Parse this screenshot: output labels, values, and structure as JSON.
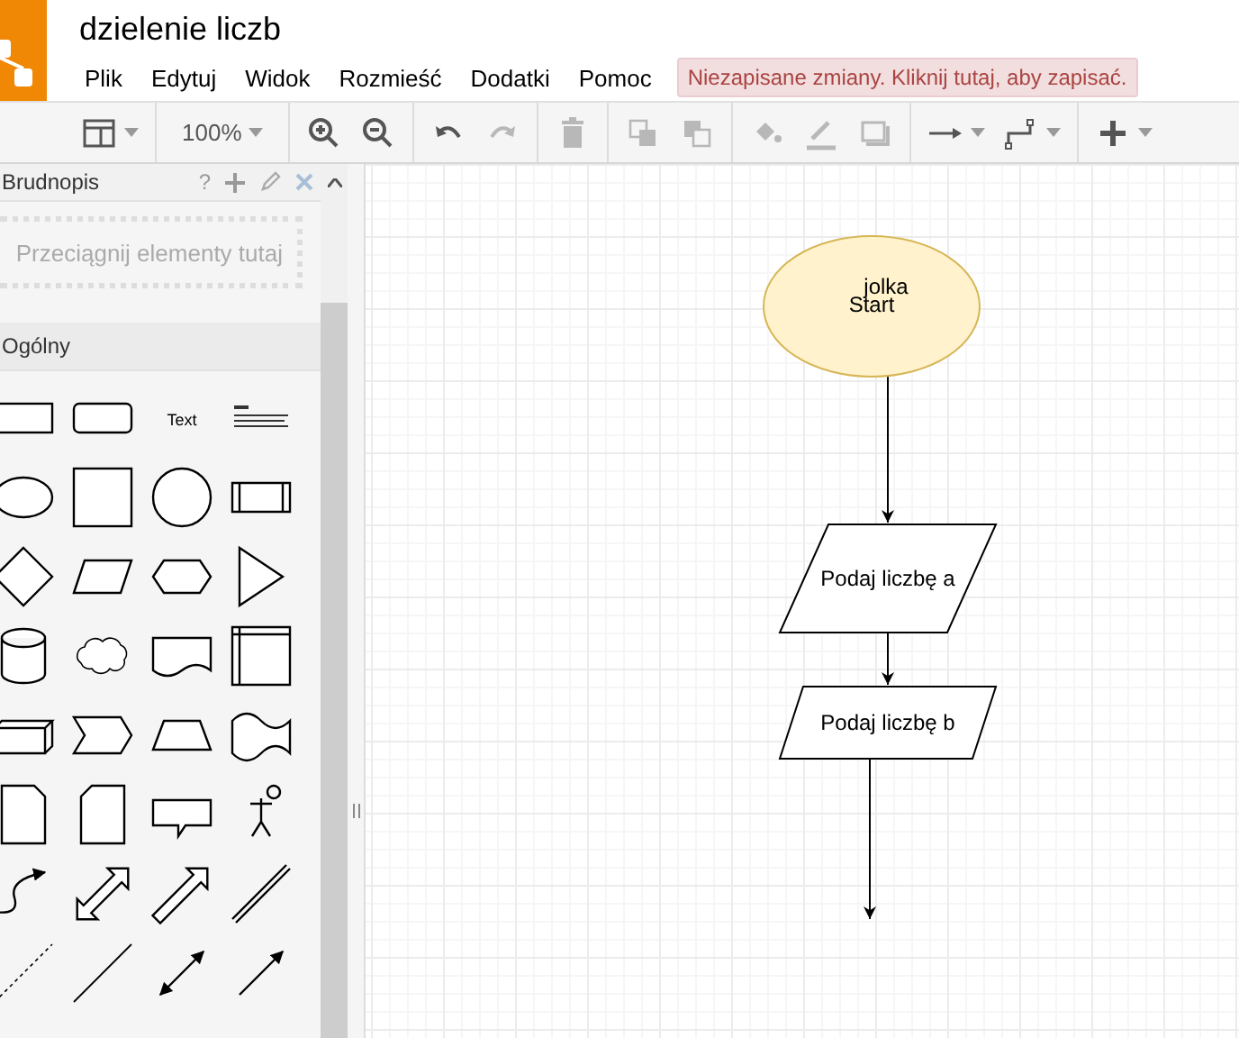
{
  "app": {
    "title": "dzielenie liczb"
  },
  "menu": [
    {
      "label": "Plik"
    },
    {
      "label": "Edytuj"
    },
    {
      "label": "Widok"
    },
    {
      "label": "Rozmieść"
    },
    {
      "label": "Dodatki"
    },
    {
      "label": "Pomoc"
    }
  ],
  "save_notice": "Niezapisane zmiany. Kliknij tutaj, aby zapisać.",
  "toolbar": {
    "tools": [
      {
        "kind": "format",
        "disabled": false
      },
      {
        "kind": "separator"
      },
      {
        "kind": "zoom",
        "label": "100%",
        "disabled": false
      },
      {
        "kind": "separator"
      },
      {
        "kind": "zoom-in",
        "disabled": false
      },
      {
        "kind": "zoom-out",
        "disabled": false
      },
      {
        "kind": "separator"
      },
      {
        "kind": "undo",
        "disabled": false
      },
      {
        "kind": "redo",
        "disabled": true
      },
      {
        "kind": "separator"
      },
      {
        "kind": "delete",
        "disabled": true
      },
      {
        "kind": "separator"
      },
      {
        "kind": "to-front",
        "disabled": true
      },
      {
        "kind": "to-back",
        "disabled": true
      },
      {
        "kind": "separator"
      },
      {
        "kind": "fill-color",
        "disabled": true
      },
      {
        "kind": "line-color",
        "disabled": true
      },
      {
        "kind": "shadow",
        "disabled": true
      },
      {
        "kind": "separator"
      },
      {
        "kind": "connection",
        "disabled": false
      },
      {
        "kind": "waypoints",
        "disabled": false
      },
      {
        "kind": "separator"
      },
      {
        "kind": "insert",
        "disabled": false
      }
    ]
  },
  "sidebar": {
    "scratchpad": {
      "title": "Brudnopis",
      "help": "?",
      "hint": "Przeciągnij elementy tutaj"
    },
    "general": {
      "title": "Ogólny",
      "shapes": [
        {
          "kind": "rect"
        },
        {
          "kind": "rounded"
        },
        {
          "kind": "text",
          "label": "Text"
        },
        {
          "kind": "textblock"
        },
        {
          "kind": "ellipse"
        },
        {
          "kind": "square"
        },
        {
          "kind": "circle"
        },
        {
          "kind": "process"
        },
        {
          "kind": "diamond"
        },
        {
          "kind": "parallelogram"
        },
        {
          "kind": "hexagon"
        },
        {
          "kind": "triangle"
        },
        {
          "kind": "cylinder"
        },
        {
          "kind": "cloud"
        },
        {
          "kind": "document"
        },
        {
          "kind": "storage"
        },
        {
          "kind": "cube"
        },
        {
          "kind": "step"
        },
        {
          "kind": "trapezoid"
        },
        {
          "kind": "tape"
        },
        {
          "kind": "note"
        },
        {
          "kind": "card"
        },
        {
          "kind": "callout"
        },
        {
          "kind": "actor"
        },
        {
          "kind": "curve"
        },
        {
          "kind": "double-arrow"
        },
        {
          "kind": "arrow"
        },
        {
          "kind": "link"
        },
        {
          "kind": "dashed-line"
        },
        {
          "kind": "line"
        },
        {
          "kind": "double-arrow-line"
        },
        {
          "kind": "arrow-line"
        }
      ]
    }
  },
  "diagram": {
    "nodes": [
      {
        "kind": "ellipse",
        "labels": [
          "jolka",
          "Start"
        ]
      },
      {
        "kind": "parallelogram",
        "labels": [
          "Podaj liczbę a"
        ]
      },
      {
        "kind": "parallelogram",
        "labels": [
          "Podaj liczbę b"
        ]
      }
    ]
  }
}
